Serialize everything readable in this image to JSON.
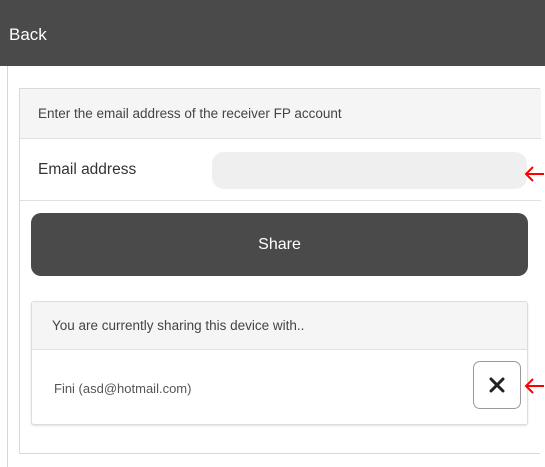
{
  "topbar": {
    "back_label": "Back",
    "background_color": "#4a4a4a"
  },
  "form": {
    "instruction": "Enter the email address of the receiver FP account",
    "email_label": "Email address",
    "email_value": "",
    "email_placeholder": "",
    "share_label": "Share"
  },
  "sharing": {
    "header": "You are currently sharing this device with..",
    "users": [
      {
        "display": "Fini (asd@hotmail.com)"
      }
    ]
  },
  "icons": {
    "remove": "close-icon",
    "annotation_pointer": "arrow-left-icon"
  },
  "colors": {
    "accent_dark": "#4a4a4a",
    "annotation_arrow": "#ff0000",
    "input_background": "#efefef"
  }
}
